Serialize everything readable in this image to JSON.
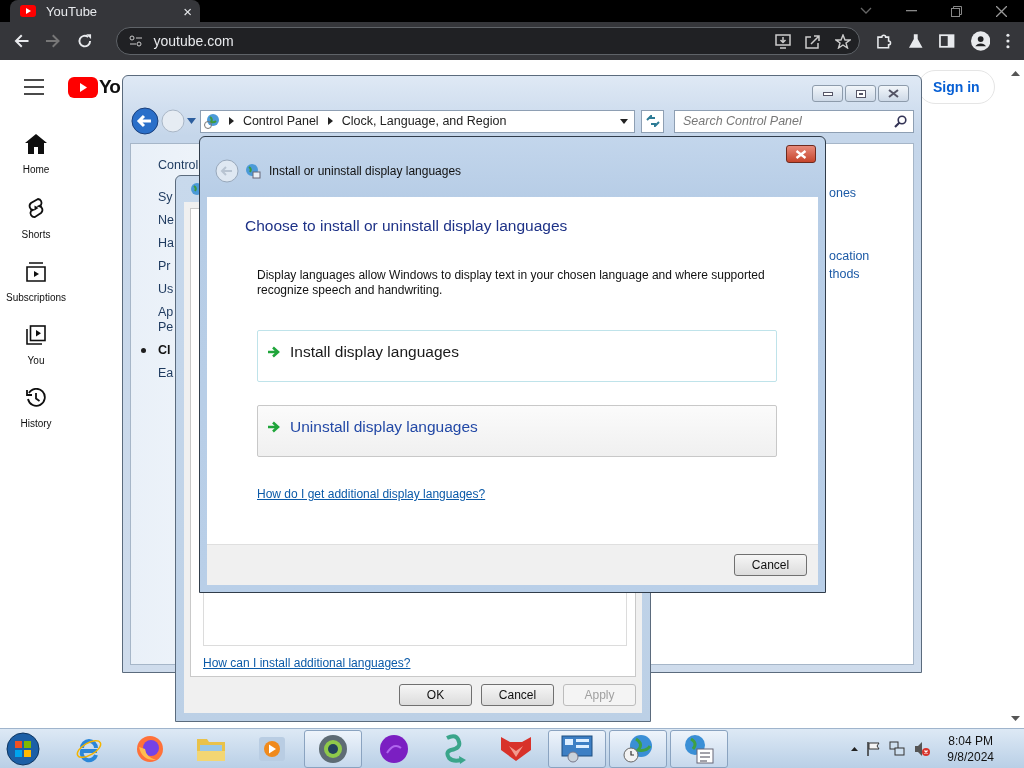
{
  "browser": {
    "tab": {
      "title": "YouTube",
      "close": "×"
    },
    "address": "youtube.com"
  },
  "youtube": {
    "logo_text": "Yo",
    "sign_in": "Sign in",
    "sidebar": [
      {
        "kind": "home",
        "label": "Home"
      },
      {
        "kind": "shorts",
        "label": "Shorts"
      },
      {
        "kind": "subscriptions",
        "label": "Subscriptions"
      },
      {
        "kind": "you",
        "label": "You"
      },
      {
        "kind": "history",
        "label": "History"
      }
    ]
  },
  "control_panel": {
    "breadcrumb": [
      "Control Panel",
      "Clock, Language, and Region"
    ],
    "search": {
      "placeholder": "Search Control Panel"
    },
    "left_pane": {
      "heading": "Control",
      "items": [
        {
          "lines": [
            "Sy"
          ],
          "selected": false
        },
        {
          "lines": [
            "Ne"
          ],
          "selected": false
        },
        {
          "lines": [
            "Ha"
          ],
          "selected": false
        },
        {
          "lines": [
            "Pr"
          ],
          "selected": false
        },
        {
          "lines": [
            "Us"
          ],
          "selected": false
        },
        {
          "lines": [
            "Ap",
            "Pe"
          ],
          "selected": false
        },
        {
          "lines": [
            "Cl"
          ],
          "selected": true
        },
        {
          "lines": [
            "Ea"
          ],
          "selected": false
        }
      ]
    },
    "right_links": [
      "ones",
      "ocation",
      "thods"
    ]
  },
  "region_dialog": {
    "link": "How can I install additional languages?",
    "buttons": [
      {
        "label": "OK",
        "disabled": false
      },
      {
        "label": "Cancel",
        "disabled": false
      },
      {
        "label": "Apply",
        "disabled": true
      }
    ]
  },
  "install_dialog": {
    "title": "Install or uninstall display languages",
    "heading": "Choose to install or uninstall display languages",
    "description": "Display languages allow Windows to display text in your chosen language and where supported recognize speech and handwriting.",
    "options": [
      {
        "label": "Install display languages",
        "hovered": false
      },
      {
        "label": "Uninstall display languages",
        "hovered": true
      }
    ],
    "help_link": "How do I get additional display languages?",
    "cancel": "Cancel"
  },
  "taskbar": {
    "items": [
      {
        "kind": "start",
        "active": false
      },
      {
        "kind": "ie",
        "active": false
      },
      {
        "kind": "firefox",
        "active": false
      },
      {
        "kind": "folder",
        "active": false
      },
      {
        "kind": "media",
        "active": false
      },
      {
        "kind": "globe-eye",
        "active": true
      },
      {
        "kind": "purple",
        "active": false
      },
      {
        "kind": "snake",
        "active": false
      },
      {
        "kind": "fox",
        "active": false
      },
      {
        "kind": "panel",
        "active": true
      },
      {
        "kind": "globe-clock",
        "active": true
      },
      {
        "kind": "globe-list",
        "active": true
      }
    ],
    "time": "8:04 PM",
    "date": "9/8/2024"
  }
}
